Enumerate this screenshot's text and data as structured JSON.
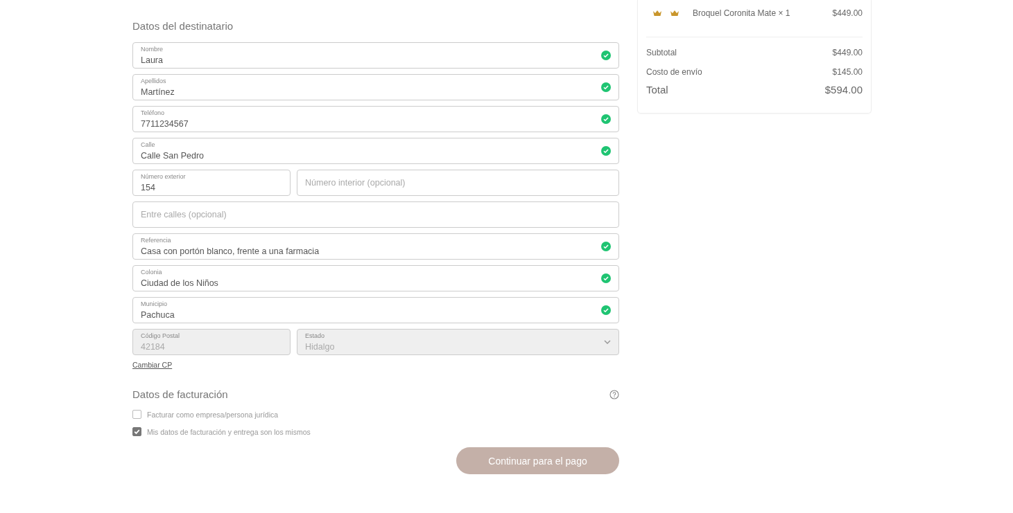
{
  "recipient": {
    "title": "Datos del destinatario",
    "rows": [
      [
        {
          "kind": "text",
          "label": "Nombre",
          "value": "Laura",
          "valid": true,
          "disabled": false
        }
      ],
      [
        {
          "kind": "text",
          "label": "Apellidos",
          "value": "Martínez",
          "valid": true,
          "disabled": false
        }
      ],
      [
        {
          "kind": "text",
          "label": "Teléfono",
          "value": "7711234567",
          "valid": true,
          "disabled": false
        }
      ],
      [
        {
          "kind": "text",
          "label": "Calle",
          "value": "Calle San Pedro",
          "valid": true,
          "disabled": false
        }
      ],
      [
        {
          "kind": "text",
          "label": "Número exterior",
          "value": "154",
          "valid": false,
          "disabled": false
        },
        {
          "kind": "text",
          "placeholder": "Número interior (opcional)",
          "valid": false,
          "disabled": false
        }
      ],
      [
        {
          "kind": "text",
          "placeholder": "Entre calles (opcional)",
          "valid": false,
          "disabled": false
        }
      ],
      [
        {
          "kind": "text",
          "label": "Referencia",
          "value": "Casa con portón blanco, frente a una farmacia",
          "valid": true,
          "disabled": false
        }
      ],
      [
        {
          "kind": "text",
          "label": "Colonia",
          "value": "Ciudad de los Niños",
          "valid": true,
          "disabled": false
        }
      ],
      [
        {
          "kind": "text",
          "label": "Municipio",
          "value": "Pachuca",
          "valid": true,
          "disabled": false
        }
      ],
      [
        {
          "kind": "text",
          "label": "Código Postal",
          "value": "42184",
          "valid": false,
          "disabled": true
        },
        {
          "kind": "select",
          "label": "Estado",
          "value": "Hidalgo",
          "valid": false,
          "disabled": true
        }
      ]
    ],
    "link": "Cambiar CP"
  },
  "billing": {
    "title": "Datos de facturación",
    "options": [
      {
        "label": "Facturar como empresa/persona jurídica",
        "checked": false
      },
      {
        "label": "Mis datos de facturación y entrega son los mismos",
        "checked": true
      }
    ]
  },
  "continue_button": "Continuar para el pago",
  "summary": {
    "item": {
      "name": "Broquel Coronita Mate × 1",
      "price": "$449.00"
    },
    "lines": [
      {
        "label": "Subtotal",
        "amount": "$449.00"
      },
      {
        "label": "Costo de envío",
        "amount": "$145.00"
      }
    ],
    "total": {
      "label": "Total",
      "amount": "$594.00"
    }
  }
}
